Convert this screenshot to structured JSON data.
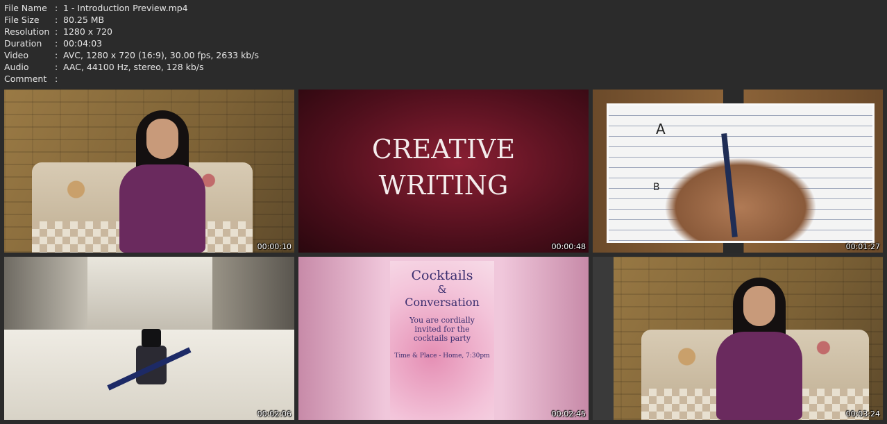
{
  "meta": [
    {
      "label": "File Name",
      "value": "1 - Introduction Preview.mp4"
    },
    {
      "label": "File Size",
      "value": "80.25 MB"
    },
    {
      "label": "Resolution",
      "value": "1280 x 720"
    },
    {
      "label": "Duration",
      "value": "00:04:03"
    },
    {
      "label": "Video",
      "value": "AVC, 1280 x 720 (16:9), 30.00 fps, 2633 kb/s"
    },
    {
      "label": "Audio",
      "value": "AAC, 44100 Hz, stereo, 128 kb/s"
    },
    {
      "label": "Comment",
      "value": ""
    }
  ],
  "separator": ":",
  "thumbnails": [
    {
      "timestamp": "00:00:10"
    },
    {
      "timestamp": "00:00:48",
      "title_line1": "CREATIVE",
      "title_line2": "WRITING"
    },
    {
      "timestamp": "00:01:27",
      "letter_a": "A",
      "letter_b": "B"
    },
    {
      "timestamp": "00:02:06"
    },
    {
      "timestamp": "00:02:45",
      "poster_line1": "Cocktails",
      "poster_line2": "&",
      "poster_line3": "Conversation",
      "poster_line4": "You are cordially",
      "poster_line5": "invited for the",
      "poster_line6": "cocktails party",
      "poster_line7": "Time & Place - Home, 7:30pm"
    },
    {
      "timestamp": "00:03:24"
    }
  ]
}
